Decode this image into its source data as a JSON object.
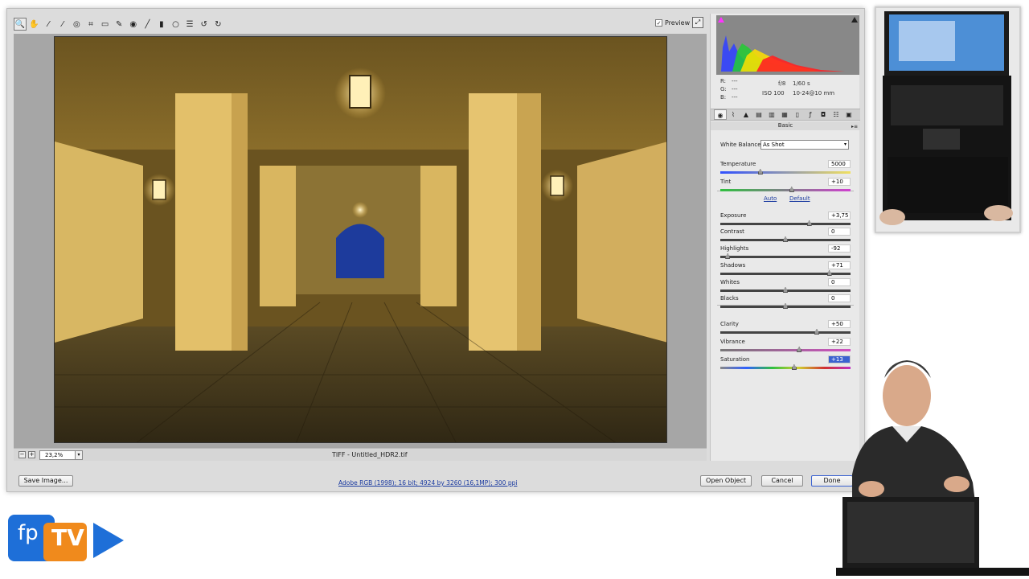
{
  "toolbar": {
    "tools": [
      "zoom-icon",
      "hand-icon",
      "white-balance-icon",
      "color-sampler-icon",
      "target-adjust-icon",
      "crop-icon",
      "straighten-icon",
      "spot-removal-icon",
      "red-eye-icon",
      "adjustment-brush-icon",
      "graduated-filter-icon",
      "radial-filter-icon",
      "preferences-icon",
      "rotate-ccw-icon",
      "rotate-cw-icon"
    ],
    "preview_label": "Preview"
  },
  "status": {
    "zoom": "23,2%",
    "file": "TIFF - Untitled_HDR2.tif"
  },
  "buttons": {
    "save_image": "Save Image...",
    "open_object": "Open Object",
    "cancel": "Cancel",
    "done": "Done"
  },
  "workflow": "Adobe RGB (1998); 16 bit; 4924 by 3260 (16,1MP); 300 ppi",
  "info": {
    "r": "R:",
    "g": "G:",
    "b": "B:",
    "r_val": "---",
    "g_val": "---",
    "b_val": "---",
    "aperture": "f/8",
    "shutter": "1/60 s",
    "iso": "ISO 100",
    "lens": "10-24@10 mm"
  },
  "panel": {
    "section": "Basic",
    "white_balance_label": "White Balance:",
    "white_balance_value": "As Shot",
    "auto": "Auto",
    "default": "Default",
    "sliders": [
      {
        "label": "Temperature",
        "value": "5000",
        "pos": 0.3
      },
      {
        "label": "Tint",
        "value": "+10",
        "pos": 0.55
      },
      {
        "label": "Exposure",
        "value": "+3,75",
        "pos": 0.69
      },
      {
        "label": "Contrast",
        "value": "0",
        "pos": 0.5
      },
      {
        "label": "Highlights",
        "value": "-92",
        "pos": 0.04
      },
      {
        "label": "Shadows",
        "value": "+71",
        "pos": 0.85
      },
      {
        "label": "Whites",
        "value": "0",
        "pos": 0.5
      },
      {
        "label": "Blacks",
        "value": "0",
        "pos": 0.5
      },
      {
        "label": "Clarity",
        "value": "+50",
        "pos": 0.75
      },
      {
        "label": "Vibrance",
        "value": "+22",
        "pos": 0.61
      },
      {
        "label": "Saturation",
        "value": "+13",
        "pos": 0.57
      }
    ]
  },
  "logo": {
    "fp": "fp",
    "tv": "TV"
  },
  "colors": {
    "accent": "#1a3aa0",
    "selection": "#3b62d0",
    "logo_blue": "#1e6fd8",
    "logo_orange": "#f08a1c"
  }
}
